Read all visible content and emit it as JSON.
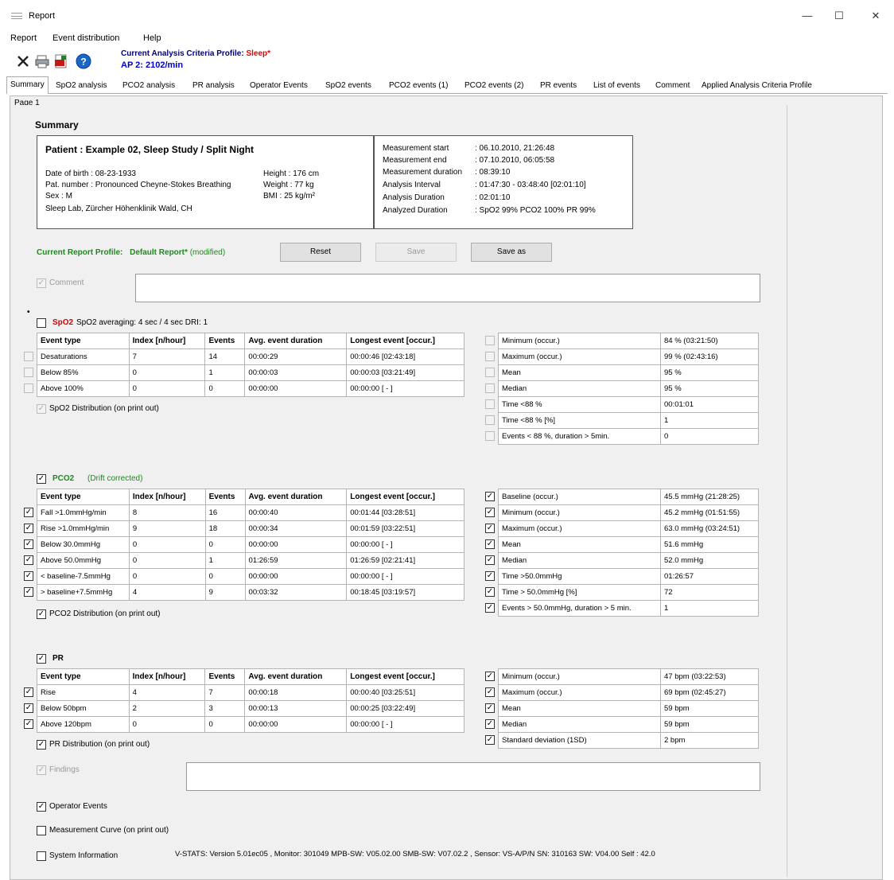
{
  "window": {
    "title": "Report",
    "minimize": "—",
    "maximize": "☐",
    "close": "✕"
  },
  "menu": {
    "items": [
      "Report",
      "Event distribution",
      "Help"
    ]
  },
  "toolbar": {
    "profile_label": "Current Analysis Criteria Profile:",
    "profile_value": "Sleep*",
    "ap_label": "AP 2: 2102/min",
    "icons": [
      "close-icon",
      "print-icon",
      "pdf-icon",
      "help-icon"
    ]
  },
  "tabs": [
    "Summary",
    "SpO2 analysis",
    "PCO2 analysis",
    "PR analysis",
    "Operator Events",
    "SpO2 events",
    "PCO2 events (1)",
    "PCO2 events (2)",
    "PR events",
    "List of events",
    "Comment",
    "Applied Analysis Criteria Profile"
  ],
  "page_label": "Page 1",
  "summary": {
    "heading": "Summary",
    "patient_title": "Patient   : Example 02, Sleep Study / Split Night",
    "dob": "Date of birth : 08-23-1933",
    "pat_number": "Pat. number : Pronounced Cheyne-Stokes Breathing",
    "sex": "Sex              : M",
    "lab": "Sleep Lab, Zürcher Höhenklinik Wald, CH",
    "height": "Height  : 176 cm",
    "weight": "Weight  : 77 kg",
    "bmi": "BMI      : 25 kg/m²",
    "meas_labels": [
      "Measurement start",
      "Measurement end",
      "Measurement duration",
      "Analysis Interval",
      "Analysis Duration",
      "Analyzed Duration"
    ],
    "meas_values": [
      ": 06.10.2010,  21:26:48",
      ": 07.10.2010,  06:05:58",
      ": 08:39:10",
      ": 01:47:30 - 03:48:40 [02:01:10]",
      ": 02:01:10",
      ": SpO2 99%   PCO2 100%   PR 99%"
    ]
  },
  "report_profile": {
    "label": "Current Report Profile:",
    "value": "Default Report*",
    "modified": "(modified)",
    "reset": "Reset",
    "save": "Save",
    "save_as": "Save as"
  },
  "comment_label": "Comment",
  "spo2": {
    "title": "SpO2",
    "info": "SpO2 averaging: 4 sec / 4 sec   DRI: 1",
    "headers": [
      "Event type",
      "Index [n/hour]",
      "Events",
      "Avg. event duration",
      "Longest event [occur.]"
    ],
    "rows": [
      [
        "Desaturations",
        "7",
        "14",
        "00:00:29",
        "00:00:46  [02:43:18]"
      ],
      [
        "Below 85%",
        "0",
        "1",
        "00:00:03",
        "00:00:03  [03:21:49]"
      ],
      [
        "Above 100%",
        "0",
        "0",
        "00:00:00",
        "00:00:00  [ - ]"
      ]
    ],
    "distribution": "SpO2 Distribution (on print out)",
    "stats": [
      [
        "Minimum (occur.)",
        "84 % (03:21:50)"
      ],
      [
        "Maximum (occur.)",
        "99 % (02:43:16)"
      ],
      [
        "Mean",
        "95 %"
      ],
      [
        "Median",
        "95 %"
      ],
      [
        "Time <88 %",
        "00:01:01"
      ],
      [
        "Time <88 % [%]",
        "1"
      ],
      [
        "Events < 88 %, duration > 5min.",
        "0"
      ]
    ]
  },
  "pco2": {
    "title": "PCO2",
    "info": "(Drift corrected)",
    "headers": [
      "Event type",
      "Index [n/hour]",
      "Events",
      "Avg. event duration",
      "Longest event [occur.]"
    ],
    "rows": [
      [
        "Fall >1.0mmHg/min",
        "8",
        "16",
        "00:00:40",
        "00:01:44  [03:28:51]"
      ],
      [
        "Rise >1.0mmHg/min",
        "9",
        "18",
        "00:00:34",
        "00:01:59  [03:22:51]"
      ],
      [
        "Below 30.0mmHg",
        "0",
        "0",
        "00:00:00",
        "00:00:00  [ - ]"
      ],
      [
        "Above 50.0mmHg",
        "0",
        "1",
        "01:26:59",
        "01:26:59  [02:21:41]"
      ],
      [
        "< baseline-7.5mmHg",
        "0",
        "0",
        "00:00:00",
        "00:00:00  [ - ]"
      ],
      [
        "> baseline+7.5mmHg",
        "4",
        "9",
        "00:03:32",
        "00:18:45  [03:19:57]"
      ]
    ],
    "distribution": "PCO2 Distribution (on print out)",
    "stats": [
      [
        "Baseline (occur.)",
        "45.5 mmHg (21:28:25)"
      ],
      [
        "Minimum (occur.)",
        "45.2 mmHg (01:51:55)"
      ],
      [
        "Maximum (occur.)",
        "63.0 mmHg (03:24:51)"
      ],
      [
        "Mean",
        "51.6 mmHg"
      ],
      [
        "Median",
        "52.0 mmHg"
      ],
      [
        "Time >50.0mmHg",
        "01:26:57"
      ],
      [
        "Time > 50.0mmHg [%]",
        "72"
      ],
      [
        "Events > 50.0mmHg, duration > 5 min.",
        "1"
      ]
    ]
  },
  "pr": {
    "title": "PR",
    "headers": [
      "Event type",
      "Index [n/hour]",
      "Events",
      "Avg. event duration",
      "Longest event [occur.]"
    ],
    "rows": [
      [
        "Rise",
        "4",
        "7",
        "00:00:18",
        "00:00:40  [03:25:51]"
      ],
      [
        "Below 50bpm",
        "2",
        "3",
        "00:00:13",
        "00:00:25  [03:22:49]"
      ],
      [
        "Above 120bpm",
        "0",
        "0",
        "00:00:00",
        "00:00:00  [ - ]"
      ]
    ],
    "distribution": "PR Distribution (on print out)",
    "stats": [
      [
        "Minimum (occur.)",
        "47 bpm (03:22:53)"
      ],
      [
        "Maximum (occur.)",
        "69 bpm (02:45:27)"
      ],
      [
        "Mean",
        "59 bpm"
      ],
      [
        "Median",
        "59 bpm"
      ],
      [
        "Standard deviation (1SD)",
        "2 bpm"
      ]
    ]
  },
  "findings_label": "Findings",
  "operator_events": "Operator Events",
  "measurement_curve": "Measurement Curve (on print out)",
  "system_info_label": "System Information",
  "system_info_value": "V-STATS: Version 5.01ec05 , Monitor: 301049 MPB-SW: V05.02.00 SMB-SW: V07.02.2 , Sensor: VS-A/P/N SN: 310163 SW: V04.00 Self : 42.0"
}
